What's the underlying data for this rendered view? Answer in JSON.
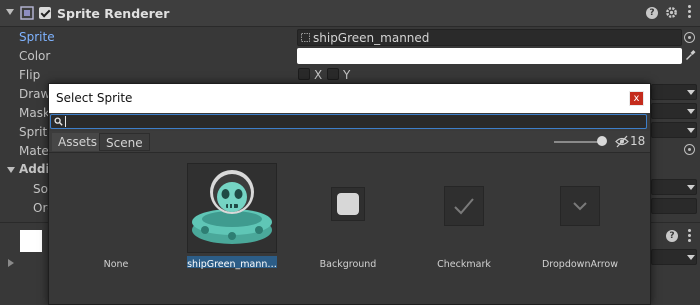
{
  "inspector": {
    "component_title": "Sprite Renderer",
    "properties": [
      {
        "label": "Sprite",
        "active": true
      },
      {
        "label": "Color"
      },
      {
        "label": "Flip"
      },
      {
        "label": "Draw"
      },
      {
        "label": "Mask"
      },
      {
        "label": "Sprite"
      },
      {
        "label": "Mater"
      }
    ],
    "additional_settings_label": "Addit",
    "sub_labels": [
      "So",
      "Orc"
    ],
    "sprite_value": "shipGreen_manned",
    "flip_x": "X",
    "flip_y": "Y",
    "icons": [
      "component-icon",
      "help-icon",
      "settings-icon",
      "more-icon",
      "eyedropper-icon",
      "object-picker-icon"
    ]
  },
  "dialog": {
    "title": "Select Sprite",
    "close_label": "x",
    "search_value": "",
    "tabs": {
      "assets": "Assets",
      "scene": "Scene"
    },
    "hidden_count": "18",
    "items": [
      {
        "label": "None",
        "selected": false
      },
      {
        "label": "shipGreen_mann…",
        "selected": true
      },
      {
        "label": "Background",
        "selected": false
      },
      {
        "label": "Checkmark",
        "selected": false
      },
      {
        "label": "DropdownArrow",
        "selected": false
      }
    ]
  }
}
